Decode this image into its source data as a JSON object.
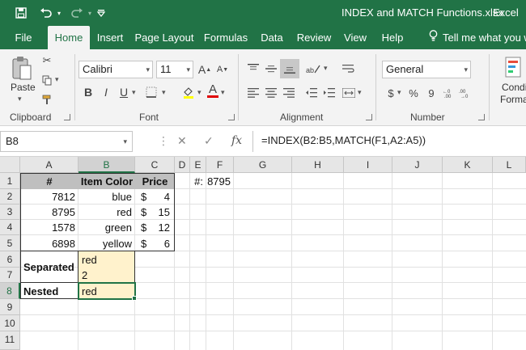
{
  "title_bar": {
    "title": "INDEX and MATCH Functions.xlsx",
    "app": "Excel",
    "quick_access": [
      "save-icon",
      "undo-icon",
      "redo-icon",
      "customize-qat-icon"
    ]
  },
  "tabs": [
    "File",
    "Home",
    "Insert",
    "Page Layout",
    "Formulas",
    "Data",
    "Review",
    "View",
    "Help"
  ],
  "active_tab": "Home",
  "tell_me": "Tell me what you wa",
  "ribbon": {
    "clipboard": {
      "paste": "Paste",
      "label": "Clipboard"
    },
    "font": {
      "name": "Calibri",
      "size": "11",
      "label": "Font",
      "bold": "B",
      "italic": "I",
      "underline": "U",
      "grow": "A",
      "shrink": "A",
      "font_color": "A"
    },
    "alignment": {
      "label": "Alignment"
    },
    "number": {
      "format": "General",
      "label": "Number",
      "currency": "$",
      "percent": "%",
      "comma": "9"
    },
    "cond_format": {
      "line1": "Condi",
      "line2": "Forma"
    }
  },
  "formula_bar": {
    "name_box": "B8",
    "cancel": "✕",
    "enter": "✓",
    "fx": "fx",
    "formula": "=INDEX(B2:B5,MATCH(F1,A2:A5))"
  },
  "grid": {
    "columns": [
      "A",
      "B",
      "C",
      "D",
      "E",
      "F",
      "G",
      "H",
      "I",
      "J",
      "K",
      "L"
    ],
    "rows": [
      "1",
      "2",
      "3",
      "4",
      "5",
      "6",
      "7",
      "8",
      "9",
      "10",
      "11"
    ],
    "header_row": [
      "#",
      "Item Color",
      "Price"
    ],
    "data_rows": [
      {
        "num": "7812",
        "color": "blue",
        "currency": "$",
        "price": "4"
      },
      {
        "num": "8795",
        "color": "red",
        "currency": "$",
        "price": "15"
      },
      {
        "num": "1578",
        "color": "green",
        "currency": "$",
        "price": "12"
      },
      {
        "num": "6898",
        "color": "yellow",
        "currency": "$",
        "price": "6"
      }
    ],
    "e1": "#:",
    "f1": "8795",
    "a6": "Separated",
    "b6": "red",
    "b7": "2",
    "a8": "Nested",
    "b8": "red"
  },
  "colors": {
    "brand": "#217346",
    "header_fill": "#bfbfbf",
    "result_fill": "#fff2cc"
  }
}
